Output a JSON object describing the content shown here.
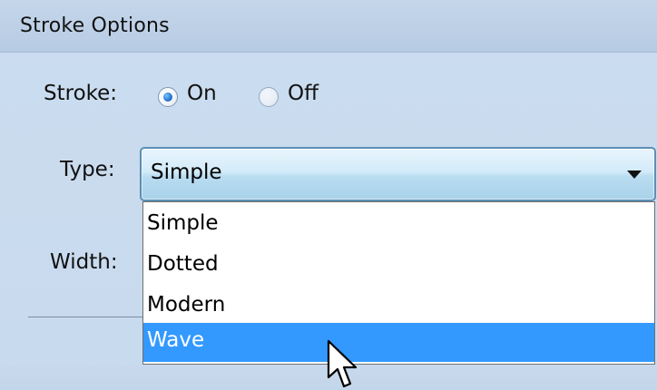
{
  "panel": {
    "title": "Stroke Options"
  },
  "stroke": {
    "label": "Stroke:",
    "on_label": "On",
    "off_label": "Off",
    "selected": "On"
  },
  "type": {
    "label": "Type:",
    "selected": "Simple",
    "options": [
      "Simple",
      "Dotted",
      "Modern",
      "Wave"
    ],
    "highlighted": "Wave"
  },
  "width": {
    "label": "Width:"
  },
  "colors": {
    "panel_bg": "#cbdcef",
    "header_bg": "#b6cbe3",
    "combo_border": "#5d8fb4",
    "highlight": "#3399ff"
  },
  "icons": {
    "combo_arrow": "chevron-down-icon",
    "cursor": "mouse-pointer-icon"
  }
}
